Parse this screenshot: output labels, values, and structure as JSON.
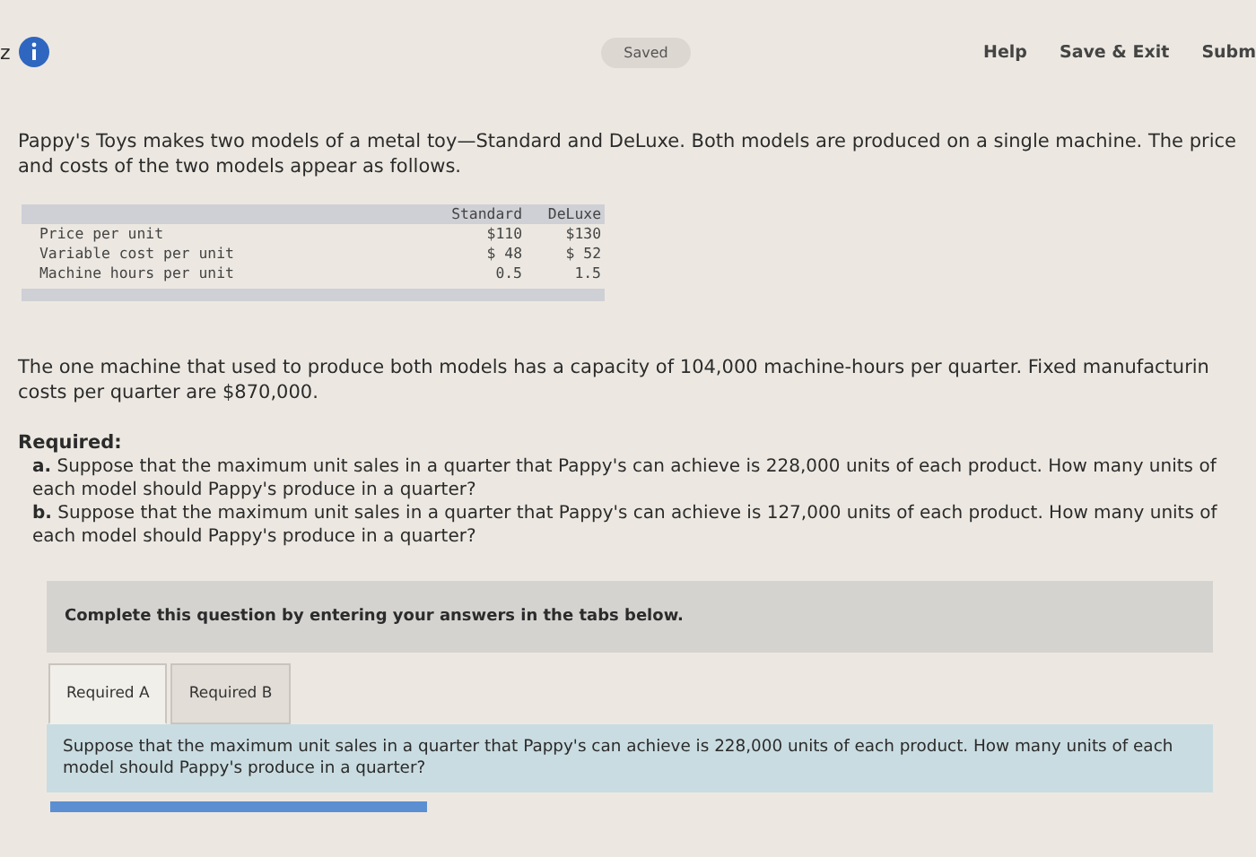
{
  "header": {
    "left_text": "z",
    "status": "Saved",
    "links": [
      "Help",
      "Save & Exit",
      "Subm"
    ]
  },
  "intro": "Pappy's Toys makes two models of a metal toy—Standard and DeLuxe. Both models are produced on a single machine. The price and costs of the two models appear as follows.",
  "table": {
    "columns": [
      "Standard",
      "DeLuxe"
    ],
    "rows": [
      {
        "label": "Price per unit",
        "values": [
          "$110",
          "$130"
        ]
      },
      {
        "label": "Variable cost per unit",
        "values": [
          "$ 48",
          "$ 52"
        ]
      },
      {
        "label": "Machine hours per unit",
        "values": [
          "0.5",
          "1.5"
        ]
      }
    ]
  },
  "capacity": "The one machine that used to produce both models has a capacity of 104,000 machine-hours per quarter. Fixed manufacturin costs per quarter are $870,000.",
  "required": {
    "heading": "Required:",
    "items": [
      "**a.** Suppose that the maximum unit sales in a quarter that Pappy's can achieve is 228,000 units of each product. How many units of each model should Pappy's produce in a quarter?",
      "**b.** Suppose that the maximum unit sales in a quarter that Pappy's can achieve is 127,000 units of each product. How many units of each model should Pappy's produce in a quarter?"
    ]
  },
  "instruction": "Complete this question by entering your answers in the tabs below.",
  "tabs": [
    {
      "label": "Required A",
      "selected": true
    },
    {
      "label": "Required B",
      "selected": false
    }
  ],
  "question": "Suppose that the maximum unit sales in a quarter that Pappy's can achieve is 228,000 units of each product. How many units of each model should Pappy's produce in a quarter?"
}
